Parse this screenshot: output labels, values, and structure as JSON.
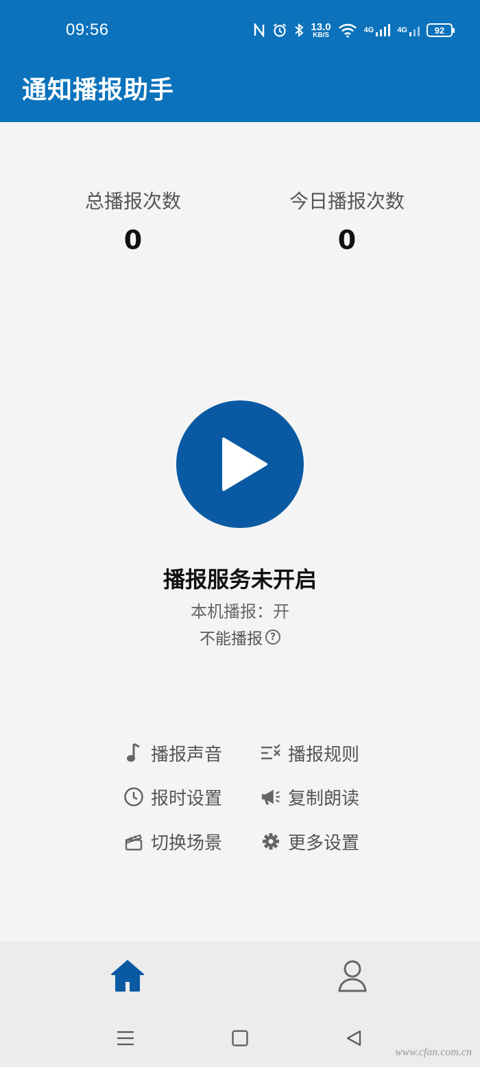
{
  "status_bar": {
    "time": "09:56",
    "net_speed_value": "13.0",
    "net_speed_unit": "KB/S",
    "signal1_label": "4G",
    "signal2_label": "4G",
    "battery": "92",
    "icons": [
      "nfc-icon",
      "alarm-icon",
      "bluetooth-icon",
      "wifi-icon",
      "signal-icon",
      "signal-icon",
      "battery-icon"
    ]
  },
  "app": {
    "title": "通知播报助手",
    "primary_color": "#0b72bb",
    "button_color": "#0a5aa3"
  },
  "stats": {
    "total_label": "总播报次数",
    "total_value": "0",
    "today_label": "今日播报次数",
    "today_value": "0"
  },
  "service": {
    "status": "播报服务未开启",
    "local_broadcast": "本机播报：开",
    "cannot_broadcast": "不能播报"
  },
  "menu": {
    "sound": "播报声音",
    "rules": "播报规则",
    "time": "报时设置",
    "copy_read": "复制朗读",
    "scene": "切换场景",
    "more": "更多设置"
  },
  "watermark": "www.cfan.com.cn"
}
